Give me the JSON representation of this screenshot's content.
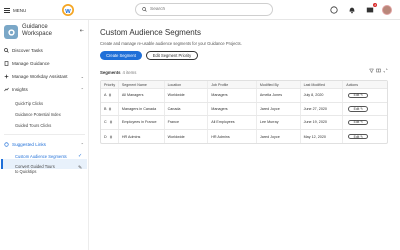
{
  "topbar": {
    "menu_label": "MENU",
    "search_placeholder": "Search",
    "notification_count": "2"
  },
  "sidebar": {
    "title": "Guidance Workspace",
    "items": [
      {
        "label": "Discover Tasks",
        "icon": "magnifier-icon"
      },
      {
        "label": "Manage Guidance",
        "icon": "document-icon"
      },
      {
        "label": "Manage Workday Assistant",
        "icon": "sparkle-icon"
      },
      {
        "label": "Insights",
        "icon": "chart-icon"
      },
      {
        "label": "Suggested Links",
        "icon": "link-icon"
      }
    ],
    "insights_sub": [
      "QuickTip Clicks",
      "Guidance Potential Index",
      "Guided Tours Clicks"
    ],
    "links_sub": [
      "Custom Audience Segments",
      "Convert Guided Tours to Quicktips"
    ]
  },
  "main": {
    "title": "Custom Audience Segments",
    "subtitle": "Create and manage re-usable audience segments for your Guidance Projects.",
    "create_button": "Create Segment",
    "priority_button": "Edit Segment Priority",
    "count_label": "Segments",
    "count_value": "4 items"
  },
  "table": {
    "headers": [
      "Priority",
      "Segment Name",
      "Location",
      "Job Profile",
      "Modified By",
      "Last Modified",
      "Actions"
    ],
    "rows": [
      [
        "A",
        "All Managers",
        "Worldwide",
        "Managers",
        "Amelia Jones",
        "July 8, 2020"
      ],
      [
        "B",
        "Managers in Canada",
        "Canada",
        "Managers",
        "Jared Joyce",
        "June 27, 2020"
      ],
      [
        "C",
        "Employees in France",
        "France",
        "All Employees",
        "Lee Murray",
        "June 19, 2020"
      ],
      [
        "D",
        "HR Admins",
        "Worldwide",
        "HR Admins",
        "Jared Joyce",
        "May 12, 2020"
      ]
    ],
    "edit_label": "Edit"
  }
}
